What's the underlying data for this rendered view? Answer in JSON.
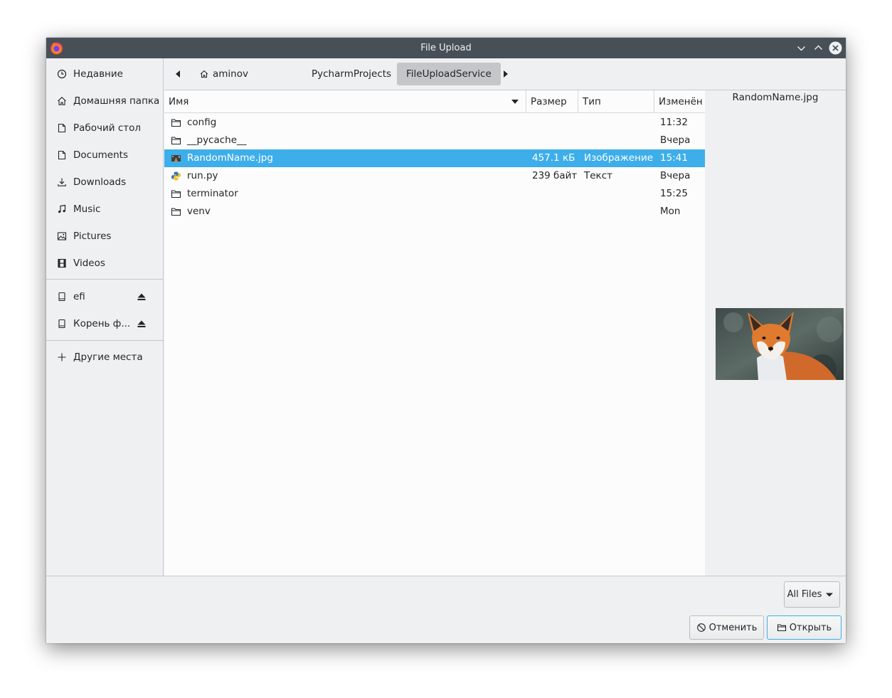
{
  "window": {
    "title": "File Upload"
  },
  "sidebar": {
    "places": [
      {
        "label": "Недавние",
        "icon": "clock-icon"
      },
      {
        "label": "Домашняя папка",
        "icon": "home-icon"
      },
      {
        "label": "Рабочий стол",
        "icon": "document-icon"
      },
      {
        "label": "Documents",
        "icon": "document-icon"
      },
      {
        "label": "Downloads",
        "icon": "download-icon"
      },
      {
        "label": "Music",
        "icon": "music-icon"
      },
      {
        "label": "Pictures",
        "icon": "image-icon"
      },
      {
        "label": "Videos",
        "icon": "film-icon"
      }
    ],
    "devices": [
      {
        "label": "efi",
        "icon": "drive-icon"
      },
      {
        "label": "Корень ф...",
        "icon": "drive-icon"
      }
    ],
    "other": {
      "label": "Другие места",
      "icon": "plus-icon"
    }
  },
  "pathbar": {
    "crumbs": [
      "aminov",
      "PycharmProjects",
      "FileUploadService"
    ],
    "active": "FileUploadService"
  },
  "filelist": {
    "columns": {
      "name": "Имя",
      "size": "Размер",
      "type": "Тип",
      "modified": "Изменён"
    },
    "rows": [
      {
        "name": "config",
        "size": "",
        "type": "",
        "modified": "11:32",
        "icon": "folder-icon"
      },
      {
        "name": "__pycache__",
        "size": "",
        "type": "",
        "modified": "Вчера",
        "icon": "folder-icon"
      },
      {
        "name": "RandomName.jpg",
        "size": "457.1 кБ",
        "type": "Изображение",
        "modified": "15:41",
        "icon": "image-file-icon",
        "selected": true
      },
      {
        "name": "run.py",
        "size": "239 байт",
        "type": "Текст",
        "modified": "Вчера",
        "icon": "python-icon"
      },
      {
        "name": "terminator",
        "size": "",
        "type": "",
        "modified": "15:25",
        "icon": "folder-icon"
      },
      {
        "name": "venv",
        "size": "",
        "type": "",
        "modified": "Mon",
        "icon": "folder-icon"
      }
    ]
  },
  "preview": {
    "filename": "RandomName.jpg"
  },
  "footer": {
    "filter_label": "All Files",
    "cancel_label": "Отменить",
    "open_label": "Открыть"
  },
  "colors": {
    "accent": "#3daee9",
    "titlebar": "#475057",
    "window_bg": "#eff0f1",
    "list_bg": "#fcfcfc"
  }
}
